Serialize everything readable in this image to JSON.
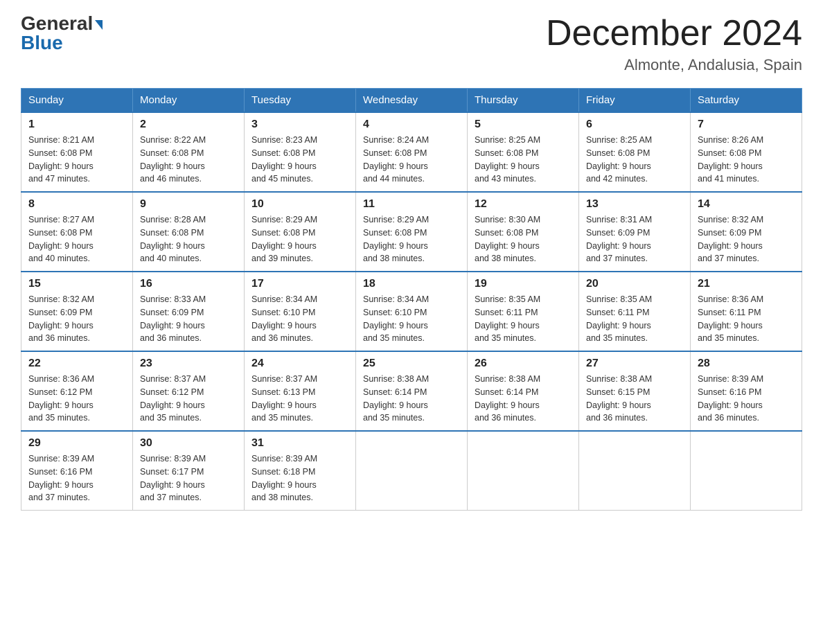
{
  "header": {
    "logo_line1": "General",
    "logo_line2": "Blue",
    "month_title": "December 2024",
    "location": "Almonte, Andalusia, Spain"
  },
  "days_of_week": [
    "Sunday",
    "Monday",
    "Tuesday",
    "Wednesday",
    "Thursday",
    "Friday",
    "Saturday"
  ],
  "weeks": [
    [
      {
        "day": "1",
        "sunrise": "8:21 AM",
        "sunset": "6:08 PM",
        "daylight": "9 hours and 47 minutes."
      },
      {
        "day": "2",
        "sunrise": "8:22 AM",
        "sunset": "6:08 PM",
        "daylight": "9 hours and 46 minutes."
      },
      {
        "day": "3",
        "sunrise": "8:23 AM",
        "sunset": "6:08 PM",
        "daylight": "9 hours and 45 minutes."
      },
      {
        "day": "4",
        "sunrise": "8:24 AM",
        "sunset": "6:08 PM",
        "daylight": "9 hours and 44 minutes."
      },
      {
        "day": "5",
        "sunrise": "8:25 AM",
        "sunset": "6:08 PM",
        "daylight": "9 hours and 43 minutes."
      },
      {
        "day": "6",
        "sunrise": "8:25 AM",
        "sunset": "6:08 PM",
        "daylight": "9 hours and 42 minutes."
      },
      {
        "day": "7",
        "sunrise": "8:26 AM",
        "sunset": "6:08 PM",
        "daylight": "9 hours and 41 minutes."
      }
    ],
    [
      {
        "day": "8",
        "sunrise": "8:27 AM",
        "sunset": "6:08 PM",
        "daylight": "9 hours and 40 minutes."
      },
      {
        "day": "9",
        "sunrise": "8:28 AM",
        "sunset": "6:08 PM",
        "daylight": "9 hours and 40 minutes."
      },
      {
        "day": "10",
        "sunrise": "8:29 AM",
        "sunset": "6:08 PM",
        "daylight": "9 hours and 39 minutes."
      },
      {
        "day": "11",
        "sunrise": "8:29 AM",
        "sunset": "6:08 PM",
        "daylight": "9 hours and 38 minutes."
      },
      {
        "day": "12",
        "sunrise": "8:30 AM",
        "sunset": "6:08 PM",
        "daylight": "9 hours and 38 minutes."
      },
      {
        "day": "13",
        "sunrise": "8:31 AM",
        "sunset": "6:09 PM",
        "daylight": "9 hours and 37 minutes."
      },
      {
        "day": "14",
        "sunrise": "8:32 AM",
        "sunset": "6:09 PM",
        "daylight": "9 hours and 37 minutes."
      }
    ],
    [
      {
        "day": "15",
        "sunrise": "8:32 AM",
        "sunset": "6:09 PM",
        "daylight": "9 hours and 36 minutes."
      },
      {
        "day": "16",
        "sunrise": "8:33 AM",
        "sunset": "6:09 PM",
        "daylight": "9 hours and 36 minutes."
      },
      {
        "day": "17",
        "sunrise": "8:34 AM",
        "sunset": "6:10 PM",
        "daylight": "9 hours and 36 minutes."
      },
      {
        "day": "18",
        "sunrise": "8:34 AM",
        "sunset": "6:10 PM",
        "daylight": "9 hours and 35 minutes."
      },
      {
        "day": "19",
        "sunrise": "8:35 AM",
        "sunset": "6:11 PM",
        "daylight": "9 hours and 35 minutes."
      },
      {
        "day": "20",
        "sunrise": "8:35 AM",
        "sunset": "6:11 PM",
        "daylight": "9 hours and 35 minutes."
      },
      {
        "day": "21",
        "sunrise": "8:36 AM",
        "sunset": "6:11 PM",
        "daylight": "9 hours and 35 minutes."
      }
    ],
    [
      {
        "day": "22",
        "sunrise": "8:36 AM",
        "sunset": "6:12 PM",
        "daylight": "9 hours and 35 minutes."
      },
      {
        "day": "23",
        "sunrise": "8:37 AM",
        "sunset": "6:12 PM",
        "daylight": "9 hours and 35 minutes."
      },
      {
        "day": "24",
        "sunrise": "8:37 AM",
        "sunset": "6:13 PM",
        "daylight": "9 hours and 35 minutes."
      },
      {
        "day": "25",
        "sunrise": "8:38 AM",
        "sunset": "6:14 PM",
        "daylight": "9 hours and 35 minutes."
      },
      {
        "day": "26",
        "sunrise": "8:38 AM",
        "sunset": "6:14 PM",
        "daylight": "9 hours and 36 minutes."
      },
      {
        "day": "27",
        "sunrise": "8:38 AM",
        "sunset": "6:15 PM",
        "daylight": "9 hours and 36 minutes."
      },
      {
        "day": "28",
        "sunrise": "8:39 AM",
        "sunset": "6:16 PM",
        "daylight": "9 hours and 36 minutes."
      }
    ],
    [
      {
        "day": "29",
        "sunrise": "8:39 AM",
        "sunset": "6:16 PM",
        "daylight": "9 hours and 37 minutes."
      },
      {
        "day": "30",
        "sunrise": "8:39 AM",
        "sunset": "6:17 PM",
        "daylight": "9 hours and 37 minutes."
      },
      {
        "day": "31",
        "sunrise": "8:39 AM",
        "sunset": "6:18 PM",
        "daylight": "9 hours and 38 minutes."
      },
      null,
      null,
      null,
      null
    ]
  ],
  "labels": {
    "sunrise": "Sunrise:",
    "sunset": "Sunset:",
    "daylight": "Daylight:"
  }
}
